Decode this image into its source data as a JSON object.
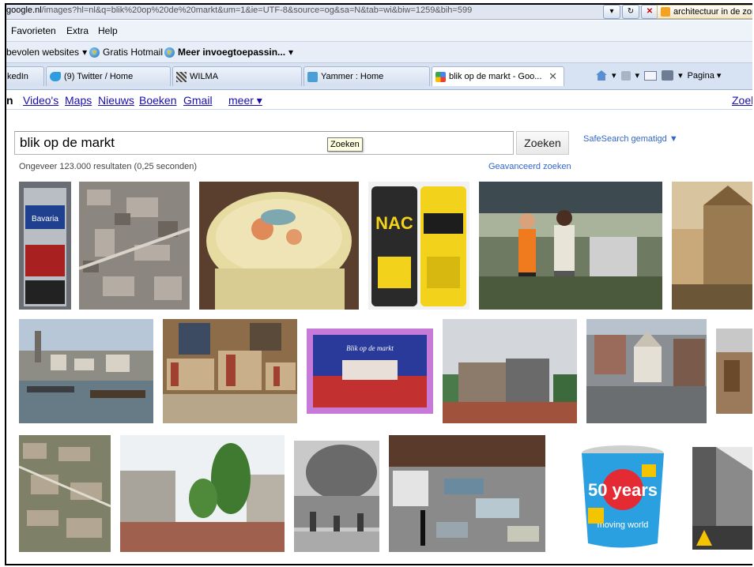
{
  "browser": {
    "url_prefix": "google.nl",
    "url_rest": "/images?hl=nl&q=blik%20op%20de%20markt&um=1&ie=UTF-8&source=og&sa=N&tab=wi&biw=1259&bih=599",
    "fav_link": "architectuur in de zorg",
    "menu": [
      "Favorieten",
      "Extra",
      "Help"
    ],
    "favorites_bar": {
      "suggested": "bevolen websites",
      "hotmail": "Gratis Hotmail",
      "more": "Meer invoegtoepassin..."
    },
    "tabs": [
      {
        "label": "kedIn"
      },
      {
        "label": "(9) Twitter / Home"
      },
      {
        "label": "WILMA"
      },
      {
        "label": "Yammer : Home"
      },
      {
        "label": "blik op de markt - Goo..."
      }
    ],
    "command_bar": {
      "page": "Pagina"
    }
  },
  "google_bar": {
    "first": "n",
    "links": [
      "Video's",
      "Maps",
      "Nieuws",
      "Boeken",
      "Gmail",
      "meer ▾"
    ],
    "right": "Zoel"
  },
  "search": {
    "query": "blik op de markt",
    "button": "Zoeken",
    "tooltip": "Zoeken",
    "safesearch": "SafeSearch gematigd ▼",
    "results": "Ongeveer 123.000 resultaten (0,25 seconden)",
    "advanced": "Geavanceerd zoeken"
  },
  "thumbnails": [
    {
      "name": "bavaria-can-thumbnail",
      "label": "Bavaria"
    },
    {
      "name": "aerial-city-thumbnail"
    },
    {
      "name": "tin-box-thumbnail"
    },
    {
      "name": "nac-cans-thumbnail",
      "label": "NAC"
    },
    {
      "name": "market-people-thumbnail"
    },
    {
      "name": "painting-thumbnail"
    },
    {
      "name": "river-town-thumbnail"
    },
    {
      "name": "book-market-thumbnail"
    },
    {
      "name": "postcard-thumbnail",
      "label": "Blik op de markt"
    },
    {
      "name": "square-buildings-thumbnail"
    },
    {
      "name": "town-hall-aerial-thumbnail"
    },
    {
      "name": "edge-photo-thumbnail"
    },
    {
      "name": "aerial-town-thumbnail"
    },
    {
      "name": "street-trees-thumbnail"
    },
    {
      "name": "bw-market-thumbnail"
    },
    {
      "name": "old-cars-thumbnail"
    },
    {
      "name": "chupa-chups-tin-thumbnail",
      "label": "50 years",
      "label2": "moving world"
    },
    {
      "name": "bw-street-thumbnail"
    }
  ]
}
